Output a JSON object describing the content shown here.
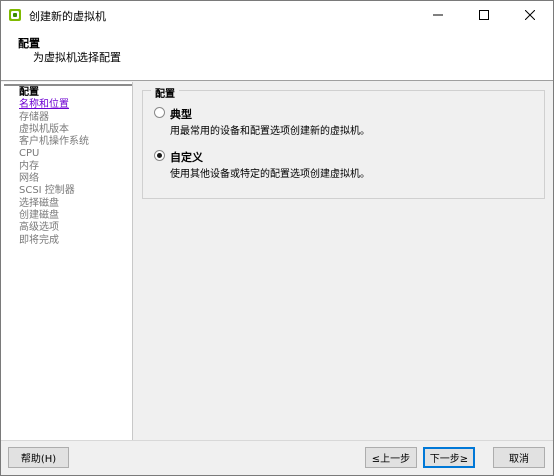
{
  "window": {
    "title": "创建新的虚拟机",
    "app_icon": "vmware-icon",
    "controls": [
      "minimize-icon",
      "maximize-icon",
      "close-icon"
    ]
  },
  "header": {
    "title": "配置",
    "subtitle": "为虚拟机选择配置"
  },
  "nav": {
    "items": [
      {
        "label": "配置",
        "state": "current"
      },
      {
        "label": "名称和位置",
        "state": "link"
      },
      {
        "label": "存储器",
        "state": "disabled"
      },
      {
        "label": "虚拟机版本",
        "state": "disabled"
      },
      {
        "label": "客户机操作系统",
        "state": "disabled"
      },
      {
        "label": "CPU",
        "state": "disabled"
      },
      {
        "label": "内存",
        "state": "disabled"
      },
      {
        "label": "网络",
        "state": "disabled"
      },
      {
        "label": "SCSI 控制器",
        "state": "disabled"
      },
      {
        "label": "选择磁盘",
        "state": "disabled"
      },
      {
        "label": "创建磁盘",
        "state": "disabled"
      },
      {
        "label": "高级选项",
        "state": "disabled"
      },
      {
        "label": "即将完成",
        "state": "disabled"
      }
    ]
  },
  "config_group": {
    "legend": "配置",
    "options": [
      {
        "label": "典型",
        "description": "用最常用的设备和配置选项创建新的虚拟机。",
        "checked": false
      },
      {
        "label": "自定义",
        "description": "使用其他设备或特定的配置选项创建虚拟机。",
        "checked": true
      }
    ]
  },
  "footer": {
    "help": "帮助(H)",
    "back": "≤上一步",
    "next": "下一步≥",
    "cancel": "取消"
  },
  "colors": {
    "link": "#6e00d2",
    "disabled_text": "#7a7a7a",
    "panel_bg": "#f0f0f0",
    "default_button_border": "#0078d7"
  }
}
